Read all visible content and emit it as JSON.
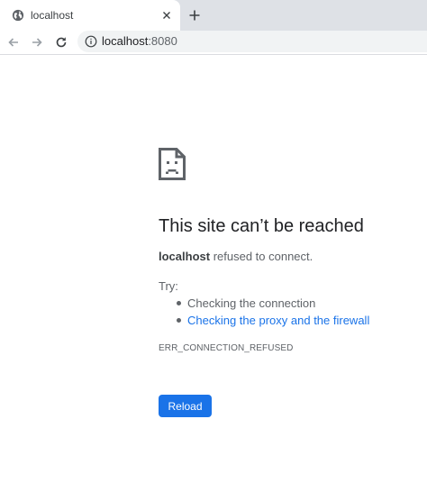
{
  "tab": {
    "title": "localhost",
    "favicon": "globe-icon",
    "close": "close-icon",
    "new_tab": "plus-icon"
  },
  "toolbar": {
    "back": "arrow-left-icon",
    "forward": "arrow-right-icon",
    "reload": "reload-icon",
    "site_info": "info-icon",
    "url_host": "localhost",
    "url_port": ":8080"
  },
  "error_page": {
    "icon": "sad-page-icon",
    "heading": "This site can’t be reached",
    "host": "localhost",
    "message": " refused to connect.",
    "try_label": "Try:",
    "suggestions": [
      {
        "text": "Checking the connection",
        "is_link": false
      },
      {
        "text": "Checking the proxy and the firewall",
        "is_link": true
      }
    ],
    "error_code": "ERR_CONNECTION_REFUSED",
    "reload_label": "Reload"
  },
  "colors": {
    "tabstrip_bg": "#dee1e6",
    "omnibox_bg": "#f1f3f4",
    "link": "#1a73e8",
    "button_bg": "#1a73e8",
    "text_primary": "#202124",
    "text_secondary": "#5f6368"
  }
}
